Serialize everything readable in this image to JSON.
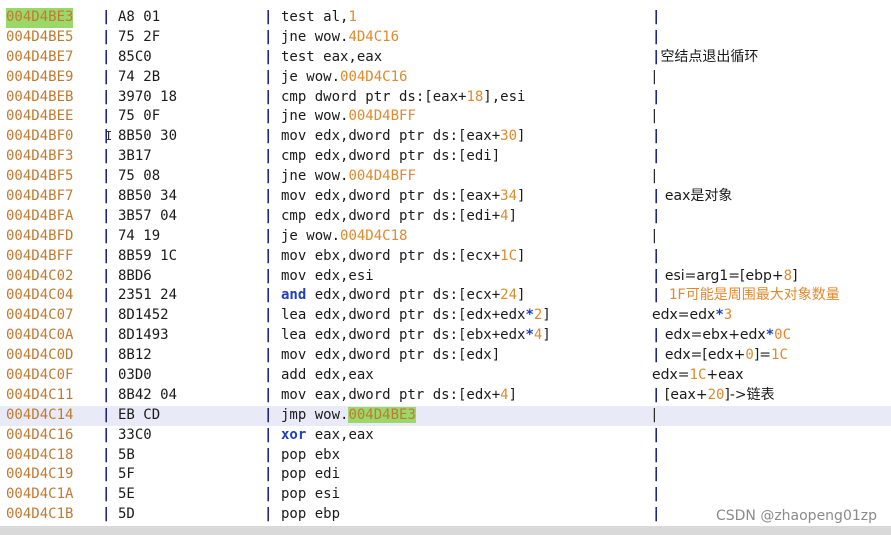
{
  "watermark": "CSDN @zhaopeng01zp",
  "separator": "|",
  "colors": {
    "address": "#c07a33",
    "number": "#e0892d",
    "keyword": "#1f3fbd",
    "highlight_row": "#e9eaf8",
    "selection": "#9bd86a"
  },
  "rows": [
    {
      "addr": "004D4BE3",
      "addr_hl": true,
      "bytes": "A8 01",
      "asm": [
        [
          "t",
          "test al,"
        ],
        [
          "n",
          "1"
        ]
      ],
      "cmt": [],
      "cmt_bar": true
    },
    {
      "addr": "004D4BE5",
      "bytes": "75 2F",
      "asm": [
        [
          "t",
          "jne wow."
        ],
        [
          "n",
          "4D4C16"
        ]
      ],
      "cmt": [],
      "cmt_bar": true
    },
    {
      "addr": "004D4BE7",
      "bytes": "85C0",
      "asm": [
        [
          "t",
          "test eax,eax"
        ]
      ],
      "cmt": [
        [
          "t",
          "空结点退出循环"
        ]
      ],
      "cmt_bar": true
    },
    {
      "addr": "004D4BE9",
      "bytes": "74 2B",
      "asm": [
        [
          "t",
          "je wow."
        ],
        [
          "n",
          "004D4C16"
        ]
      ],
      "cmt": [
        [
          "t",
          "   |"
        ]
      ],
      "cmt_bar": false
    },
    {
      "addr": "004D4BEB",
      "bytes": "3970 18",
      "asm": [
        [
          "t",
          "cmp dword ptr ds:[eax+"
        ],
        [
          "n",
          "18"
        ],
        [
          "t",
          "],esi"
        ]
      ],
      "cmt": [],
      "cmt_bar": true
    },
    {
      "addr": "004D4BEE",
      "bytes": "75 0F",
      "asm": [
        [
          "t",
          "jne wow."
        ],
        [
          "n",
          "004D4BFF"
        ]
      ],
      "cmt": [
        [
          "t",
          "   |"
        ]
      ],
      "cmt_bar": false
    },
    {
      "addr": "004D4BF0",
      "bytes": "8B50 30",
      "asm": [
        [
          "t",
          "mov edx,dword ptr ds:[eax+"
        ],
        [
          "n",
          "30"
        ],
        [
          "t",
          "]"
        ]
      ],
      "cmt": [],
      "cmt_bar": true
    },
    {
      "addr": "004D4BF3",
      "bytes": "3B17",
      "asm": [
        [
          "t",
          "cmp edx,dword ptr ds:[edi]"
        ]
      ],
      "cmt": [],
      "cmt_bar": true
    },
    {
      "addr": "004D4BF5",
      "bytes": "75 08",
      "asm": [
        [
          "t",
          "jne wow."
        ],
        [
          "n",
          "004D4BFF"
        ]
      ],
      "cmt": [
        [
          "t",
          "   |"
        ]
      ],
      "cmt_bar": false
    },
    {
      "addr": "004D4BF7",
      "bytes": "8B50 34",
      "asm": [
        [
          "t",
          "mov edx,dword ptr ds:[eax+"
        ],
        [
          "n",
          "34"
        ],
        [
          "t",
          "]"
        ]
      ],
      "cmt": [
        [
          "t",
          " eax是对象"
        ]
      ],
      "cmt_bar": true
    },
    {
      "addr": "004D4BFA",
      "bytes": "3B57 04",
      "asm": [
        [
          "t",
          "cmp edx,dword ptr ds:[edi+"
        ],
        [
          "n",
          "4"
        ],
        [
          "t",
          "]"
        ]
      ],
      "cmt": [],
      "cmt_bar": true
    },
    {
      "addr": "004D4BFD",
      "bytes": "74 19",
      "asm": [
        [
          "t",
          "je wow."
        ],
        [
          "n",
          "004D4C18"
        ]
      ],
      "cmt": [
        [
          "t",
          "   |"
        ]
      ],
      "cmt_bar": false
    },
    {
      "addr": "004D4BFF",
      "bytes": "8B59 1C",
      "asm": [
        [
          "t",
          "mov ebx,dword ptr ds:[ecx+"
        ],
        [
          "n",
          "1C"
        ],
        [
          "t",
          "]"
        ]
      ],
      "cmt": [],
      "cmt_bar": true
    },
    {
      "addr": "004D4C02",
      "bytes": "8BD6",
      "asm": [
        [
          "t",
          "mov edx,esi"
        ]
      ],
      "cmt": [
        [
          "t",
          " esi=arg1=[ebp+"
        ],
        [
          "n",
          "8"
        ],
        [
          "t",
          "]"
        ]
      ],
      "cmt_bar": true
    },
    {
      "addr": "004D4C04",
      "bytes": "2351 24",
      "asm": [
        [
          "k",
          "and"
        ],
        [
          "t",
          " edx,dword ptr ds:[ecx+"
        ],
        [
          "n",
          "24"
        ],
        [
          "t",
          "]"
        ]
      ],
      "cmt": [
        [
          "o",
          " 1F可能是周围最大对象数量"
        ]
      ],
      "cmt_bar": true
    },
    {
      "addr": "004D4C07",
      "bytes": "8D1452",
      "asm": [
        [
          "t",
          "lea edx,dword ptr ds:[edx+edx"
        ],
        [
          "m",
          "*"
        ],
        [
          "n",
          "2"
        ],
        [
          "t",
          "]"
        ]
      ],
      "cmt": [
        [
          "t",
          " edx=edx"
        ],
        [
          "m",
          "*"
        ],
        [
          "n",
          "3"
        ]
      ],
      "cmt_bar": false
    },
    {
      "addr": "004D4C0A",
      "bytes": "8D1493",
      "asm": [
        [
          "t",
          "lea edx,dword ptr ds:[ebx+edx"
        ],
        [
          "m",
          "*"
        ],
        [
          "n",
          "4"
        ],
        [
          "t",
          "]"
        ]
      ],
      "cmt": [
        [
          "t",
          " edx=ebx+edx"
        ],
        [
          "m",
          "*"
        ],
        [
          "n",
          "0C"
        ]
      ],
      "cmt_bar": true
    },
    {
      "addr": "004D4C0D",
      "bytes": "8B12",
      "asm": [
        [
          "t",
          "mov edx,dword ptr ds:[edx]"
        ]
      ],
      "cmt": [
        [
          "t",
          " edx=[edx+"
        ],
        [
          "n",
          "0"
        ],
        [
          "t",
          "]="
        ],
        [
          "n",
          "1C"
        ]
      ],
      "cmt_bar": true
    },
    {
      "addr": "004D4C0F",
      "bytes": "03D0",
      "asm": [
        [
          "t",
          "add edx,eax"
        ]
      ],
      "cmt": [
        [
          "t",
          " edx="
        ],
        [
          "n",
          "1C"
        ],
        [
          "t",
          "+eax"
        ]
      ],
      "cmt_bar": false
    },
    {
      "addr": "004D4C11",
      "bytes": "8B42 04",
      "asm": [
        [
          "t",
          "mov eax,dword ptr ds:[edx+"
        ],
        [
          "n",
          "4"
        ],
        [
          "t",
          "]"
        ]
      ],
      "cmt": [
        [
          "t",
          " [eax+"
        ],
        [
          "n",
          "20"
        ],
        [
          "t",
          "]->链表"
        ]
      ],
      "cmt_bar": true
    },
    {
      "addr": "004D4C14",
      "bytes": "EB CD",
      "hl": true,
      "asm": [
        [
          "t",
          "jmp wow."
        ],
        [
          "s",
          "004D4BE3"
        ]
      ],
      "cmt": [
        [
          "t",
          "   |"
        ]
      ],
      "cmt_bar": false
    },
    {
      "addr": "004D4C16",
      "bytes": "33C0",
      "asm": [
        [
          "k",
          "xor"
        ],
        [
          "t",
          " eax,eax"
        ]
      ],
      "cmt": [],
      "cmt_bar": true
    },
    {
      "addr": "004D4C18",
      "bytes": "5B",
      "asm": [
        [
          "t",
          "pop ebx"
        ]
      ],
      "cmt": [],
      "cmt_bar": true
    },
    {
      "addr": "004D4C19",
      "bytes": "5F",
      "asm": [
        [
          "t",
          "pop edi"
        ]
      ],
      "cmt": [],
      "cmt_bar": true
    },
    {
      "addr": "004D4C1A",
      "bytes": "5E",
      "asm": [
        [
          "t",
          "pop esi"
        ]
      ],
      "cmt": [],
      "cmt_bar": true
    },
    {
      "addr": "004D4C1B",
      "bytes": "5D",
      "asm": [
        [
          "t",
          "pop ebp"
        ]
      ],
      "cmt": [],
      "cmt_bar": true
    }
  ]
}
